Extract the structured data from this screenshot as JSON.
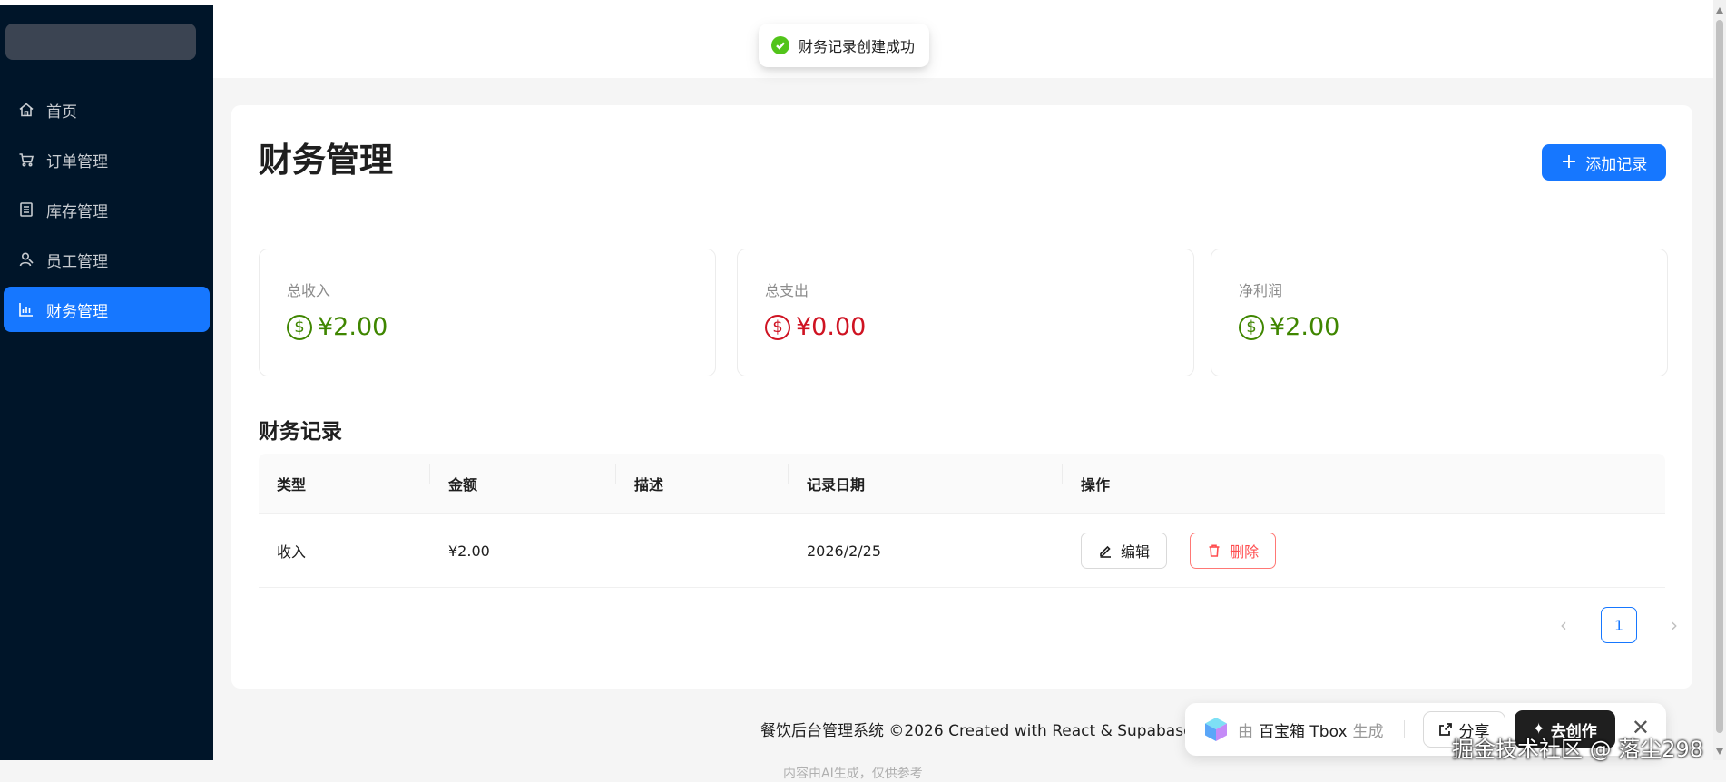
{
  "toast": {
    "message": "财务记录创建成功"
  },
  "sidebar": {
    "items": [
      {
        "label": "首页",
        "icon": "home-icon"
      },
      {
        "label": "订单管理",
        "icon": "cart-icon"
      },
      {
        "label": "库存管理",
        "icon": "inventory-icon"
      },
      {
        "label": "员工管理",
        "icon": "user-icon"
      },
      {
        "label": "财务管理",
        "icon": "bar-chart-icon",
        "active": true
      }
    ]
  },
  "main": {
    "title": "财务管理",
    "add_button": "添加记录",
    "stats": [
      {
        "label": "总收入",
        "value": "¥2.00",
        "color": "#3f8600"
      },
      {
        "label": "总支出",
        "value": "¥0.00",
        "color": "#cf1322"
      },
      {
        "label": "净利润",
        "value": "¥2.00",
        "color": "#3f8600"
      }
    ],
    "records_title": "财务记录",
    "table": {
      "headers": [
        "类型",
        "金额",
        "描述",
        "记录日期",
        "操作"
      ],
      "rows": [
        {
          "type": "收入",
          "amount": "¥2.00",
          "description": "",
          "date": "2026/2/25"
        }
      ],
      "edit_label": "编辑",
      "delete_label": "删除"
    },
    "pagination": {
      "current": "1"
    }
  },
  "footer": {
    "text": "餐饮后台管理系统 ©2026 Created with React & Supabase",
    "ai_note": "内容由AI生成，仅供参考"
  },
  "tbox": {
    "by": "由",
    "brand": "百宝箱 Tbox",
    "generated": "生成",
    "share": "分享",
    "create": "去创作"
  },
  "watermark": "掘金技术社区 @ 落尘298",
  "colors": {
    "primary": "#1677ff",
    "sidebar_bg": "#001529",
    "success": "#52c41a",
    "danger": "#ff4d4f"
  }
}
